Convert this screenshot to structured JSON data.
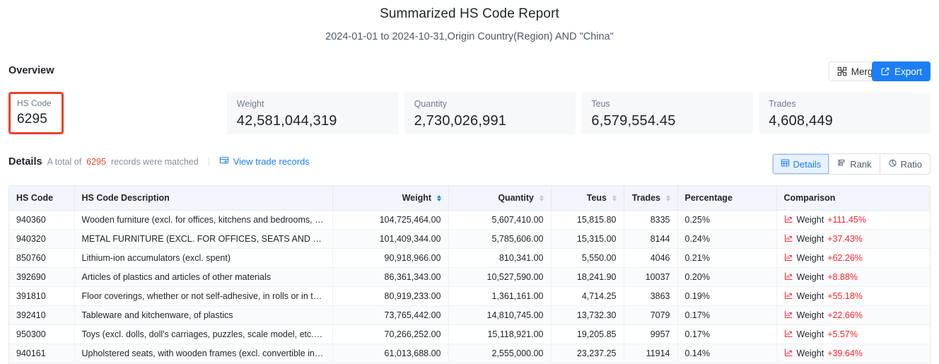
{
  "header": {
    "title": "Summarized HS Code Report",
    "subtitle": "2024-01-01 to 2024-10-31,Origin Country(Region) AND \"China\""
  },
  "overview": {
    "label": "Overview",
    "merge_label": "Merge",
    "export_label": "Export",
    "cards": [
      {
        "label": "HS Code",
        "value": "6295",
        "highlighted": true
      },
      {
        "label": "Weight",
        "value": "42,581,044,319"
      },
      {
        "label": "Quantity",
        "value": "2,730,026,991"
      },
      {
        "label": "Teus",
        "value": "6,579,554.45"
      },
      {
        "label": "Trades",
        "value": "4,608,449"
      }
    ]
  },
  "details": {
    "title": "Details",
    "prefix_text": "A total of",
    "count": "6295",
    "suffix_text": "records were matched",
    "trade_link": "View trade records",
    "view_modes": [
      {
        "label": "Details",
        "active": true
      },
      {
        "label": "Rank",
        "active": false
      },
      {
        "label": "Ratio",
        "active": false
      }
    ]
  },
  "table": {
    "columns": [
      {
        "label": "HS Code",
        "align": "left",
        "sortable": false
      },
      {
        "label": "HS Code Description",
        "align": "left",
        "sortable": false
      },
      {
        "label": "Weight",
        "align": "right",
        "sortable": true,
        "sort_active": true
      },
      {
        "label": "Quantity",
        "align": "right",
        "sortable": true,
        "sort_active": false
      },
      {
        "label": "Teus",
        "align": "right",
        "sortable": true,
        "sort_active": false
      },
      {
        "label": "Trades",
        "align": "right",
        "sortable": true,
        "sort_active": false
      },
      {
        "label": "Percentage",
        "align": "left",
        "sortable": false
      },
      {
        "label": "Comparison",
        "align": "left",
        "sortable": false
      }
    ],
    "rows": [
      {
        "hs_code": "940360",
        "description": "Wooden furniture (excl. for offices, kitchens and bedrooms, and seat...",
        "weight": "104,725,464.00",
        "quantity": "5,607,410.00",
        "teus": "15,815.80",
        "trades": "8335",
        "percentage": "0.25%",
        "comparison_label": "Weight",
        "comparison_value": "+111.45%"
      },
      {
        "hs_code": "940320",
        "description": "METAL FURNITURE (EXCL. FOR OFFICES, SEATS AND MEDICAL, SU...",
        "weight": "101,409,344.00",
        "quantity": "5,785,606.00",
        "teus": "15,315.00",
        "trades": "8144",
        "percentage": "0.24%",
        "comparison_label": "Weight",
        "comparison_value": "+37.43%"
      },
      {
        "hs_code": "850760",
        "description": "Lithium-ion accumulators (excl. spent)",
        "weight": "90,918,966.00",
        "quantity": "810,341.00",
        "teus": "5,550.00",
        "trades": "4046",
        "percentage": "0.21%",
        "comparison_label": "Weight",
        "comparison_value": "+62.26%"
      },
      {
        "hs_code": "392690",
        "description": "Articles of plastics and articles of other materials",
        "weight": "86,361,343.00",
        "quantity": "10,527,590.00",
        "teus": "18,241.90",
        "trades": "10037",
        "percentage": "0.20%",
        "comparison_label": "Weight",
        "comparison_value": "+8.88%"
      },
      {
        "hs_code": "391810",
        "description": "Floor coverings, whether or not self-adhesive, in rolls or in the form ...",
        "weight": "80,919,233.00",
        "quantity": "1,361,161.00",
        "teus": "4,714.25",
        "trades": "3863",
        "percentage": "0.19%",
        "comparison_label": "Weight",
        "comparison_value": "+55.18%"
      },
      {
        "hs_code": "392410",
        "description": "Tableware and kitchenware, of plastics",
        "weight": "73,765,442.00",
        "quantity": "14,810,745.00",
        "teus": "13,732.30",
        "trades": "7079",
        "percentage": "0.17%",
        "comparison_label": "Weight",
        "comparison_value": "+22.66%"
      },
      {
        "hs_code": "950300",
        "description": "Toys (excl. dolls, doll's carriages, puzzles, scale model, etc.) (excl. g...",
        "weight": "70,266,252.00",
        "quantity": "15,118,921.00",
        "teus": "19,205.85",
        "trades": "9957",
        "percentage": "0.17%",
        "comparison_label": "Weight",
        "comparison_value": "+5.57%"
      },
      {
        "hs_code": "940161",
        "description": "Upholstered seats, with wooden frames (excl. convertible into beds)",
        "weight": "61,013,688.00",
        "quantity": "2,555,000.00",
        "teus": "23,237.25",
        "trades": "11914",
        "percentage": "0.14%",
        "comparison_label": "Weight",
        "comparison_value": "+39.64%"
      }
    ]
  },
  "colors": {
    "accent_blue": "#1b7ef5",
    "highlight_red": "#e8422a",
    "value_red": "#f5222d"
  }
}
